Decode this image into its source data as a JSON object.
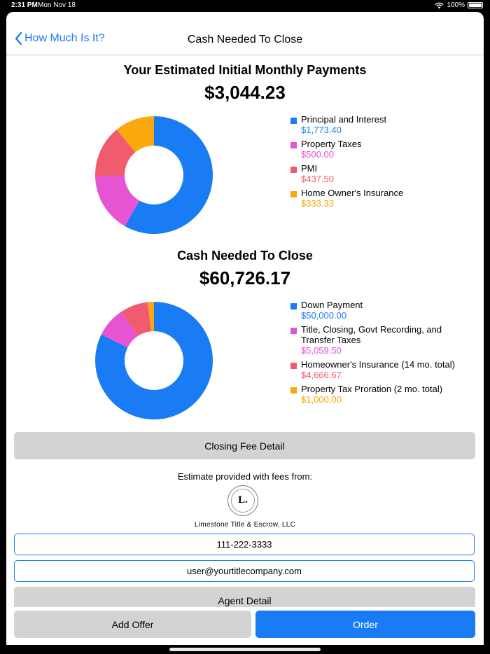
{
  "status_bar": {
    "time": "2:31 PM",
    "date": "Mon Nov 18",
    "battery": "100%"
  },
  "nav": {
    "back_label": "How Much Is It?",
    "title": "Cash Needed To Close"
  },
  "monthly": {
    "title": "Your Estimated Initial Monthly Payments",
    "total": "$3,044.23",
    "items": [
      {
        "label": "Principal and Interest",
        "value": "$1,773.40",
        "amount": 1773.4,
        "color": "#1a7cf5"
      },
      {
        "label": "Property Taxes",
        "value": "$500.00",
        "amount": 500.0,
        "color": "#e653d3"
      },
      {
        "label": "PMI",
        "value": "$437.50",
        "amount": 437.5,
        "color": "#f05b6f"
      },
      {
        "label": "Home Owner's Insurance",
        "value": "$333.33",
        "amount": 333.33,
        "color": "#f9a80d"
      }
    ]
  },
  "closing": {
    "title": "Cash Needed To Close",
    "total": "$60,726.17",
    "items": [
      {
        "label": "Down Payment",
        "value": "$50,000.00",
        "amount": 50000.0,
        "color": "#1a7cf5"
      },
      {
        "label": "Title, Closing, Govt Recording, and Transfer Taxes",
        "value": "$5,059.50",
        "amount": 5059.5,
        "color": "#e653d3"
      },
      {
        "label": "Homeowner's Insurance (14 mo. total)",
        "value": "$4,666.67",
        "amount": 4666.67,
        "color": "#f05b6f"
      },
      {
        "label": "Property Tax Proration (2 mo. total)",
        "value": "$1,000.00",
        "amount": 1000.0,
        "color": "#f9a80d"
      }
    ]
  },
  "closing_fee_button": "Closing Fee Detail",
  "provider": {
    "intro": "Estimate provided with fees from:",
    "logo_letter": "L.",
    "logo_text": "LIMESTONE TITLE & ESCROW LLC",
    "name": "Limestone Title & Escrow, LLC",
    "phone": "111-222-3333",
    "email": "user@yourtitlecompany.com"
  },
  "agent_button": "Agent Detail",
  "bottom": {
    "add_offer": "Add Offer",
    "order": "Order"
  }
}
